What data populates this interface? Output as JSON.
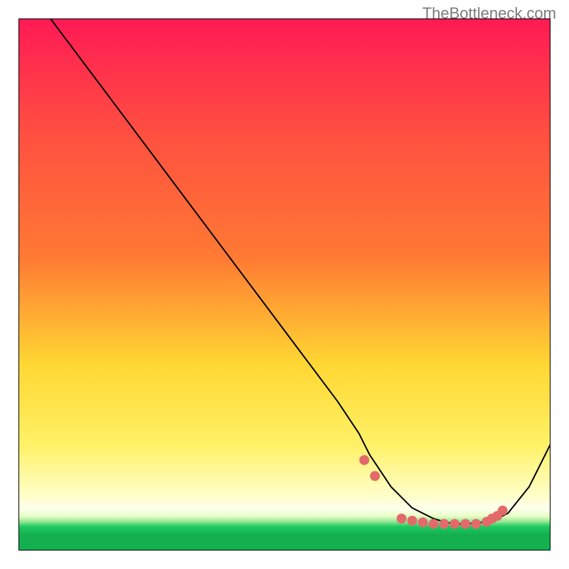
{
  "watermark": "TheBottleneck.com",
  "chart_data": {
    "type": "line",
    "title": "",
    "xlabel": "",
    "ylabel": "",
    "xlim": [
      0,
      100
    ],
    "ylim": [
      0,
      100
    ],
    "background_gradient": {
      "top": "#ff1a55",
      "upper_mid": "#ff7a33",
      "mid": "#ffd733",
      "lower_mid": "#fff166",
      "pale_yellow": "#ffffcc",
      "green": "#1ecb5f"
    },
    "series": [
      {
        "name": "bottleneck-curve",
        "color": "#000000",
        "x": [
          6,
          9,
          12,
          18,
          24,
          30,
          36,
          42,
          48,
          54,
          60,
          64,
          66,
          70,
          72,
          74,
          76,
          78,
          80,
          82,
          84,
          86,
          88,
          90,
          92,
          96,
          100
        ],
        "y": [
          100,
          96,
          92,
          84,
          76,
          68,
          60,
          52,
          44,
          36,
          28,
          22,
          18,
          12,
          10,
          8,
          7,
          6,
          5.4,
          5,
          5,
          5.2,
          5.4,
          6,
          7,
          12,
          20
        ]
      }
    ],
    "dots": {
      "name": "highlight-dots",
      "color": "#e36a6a",
      "radius": 7,
      "x": [
        65,
        67,
        72,
        74,
        76,
        78,
        80,
        82,
        84,
        86,
        88,
        89,
        90,
        91
      ],
      "y": [
        17,
        14,
        6,
        5.6,
        5.3,
        5,
        5,
        5,
        5,
        5,
        5.4,
        6,
        6.5,
        7.5
      ]
    }
  }
}
